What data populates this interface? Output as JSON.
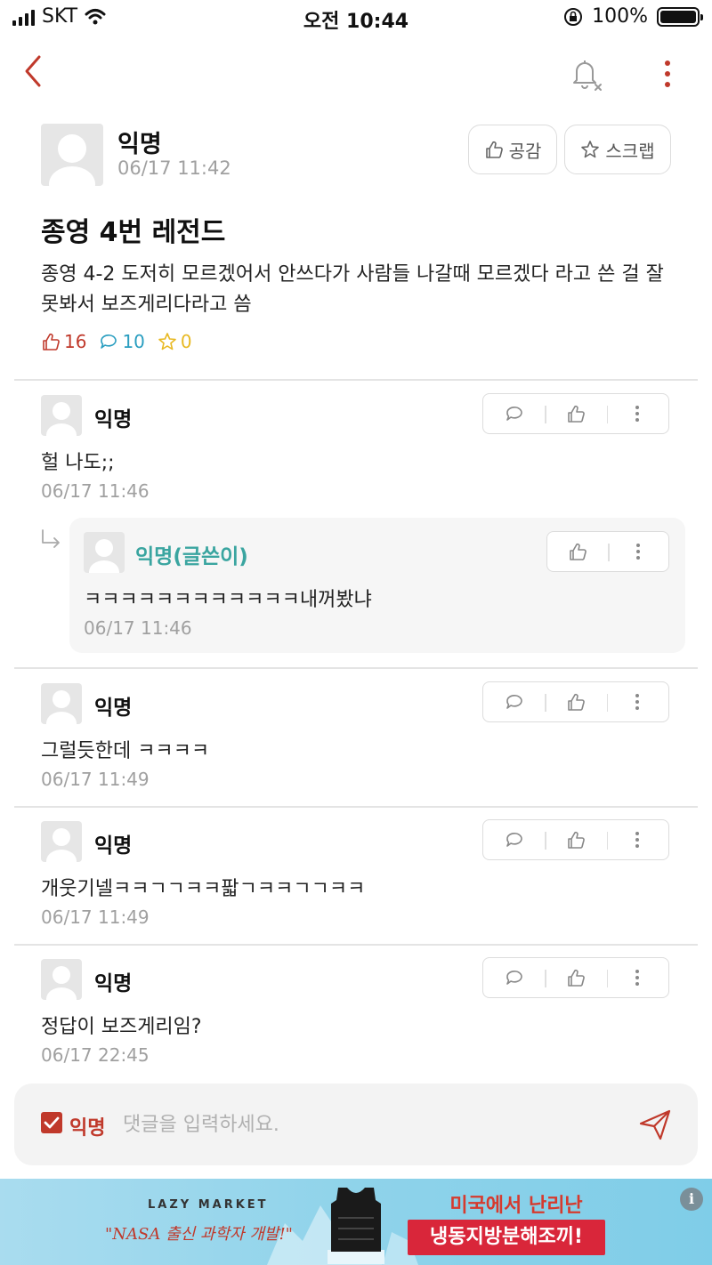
{
  "status_bar": {
    "carrier": "SKT",
    "time": "오전 10:44",
    "battery": "100%"
  },
  "post": {
    "author": "익명",
    "time": "06/17 11:42",
    "like_label": "공감",
    "scrap_label": "스크랩",
    "title": "종영 4번 레전드",
    "body": "종영 4-2 도저히 모르겠어서 안쓰다가 사람들 나갈때  모르겠다 라고 쓴 걸 잘못봐서 보즈게리다라고 씀",
    "likes": "16",
    "comments": "10",
    "scraps": "0"
  },
  "comments": [
    {
      "author": "익명",
      "text": "헐 나도;;",
      "time": "06/17 11:46"
    },
    {
      "author": "익명(글쓴이)",
      "text": "ㅋㅋㅋㅋㅋㅋㅋㅋㅋㅋㅋㅋ내꺼봤냐",
      "time": "06/17 11:46"
    },
    {
      "author": "익명",
      "text": "그럴듯한데 ㅋㅋㅋㅋ",
      "time": "06/17 11:49"
    },
    {
      "author": "익명",
      "text": "개웃기넬ㅋㅋㄱㄱㅋㅋ팗ㄱㅋㅋㄱㄱㅋㅋ",
      "time": "06/17 11:49"
    },
    {
      "author": "익명",
      "text": "정답이 보즈게리임?",
      "time": "06/17 22:45"
    }
  ],
  "input": {
    "anon_label": "익명",
    "placeholder": "댓글을 입력하세요."
  },
  "ad": {
    "brand": "LAZY MARKET",
    "slogan": "\"NASA 출신 과학자 개발!\"",
    "headline": "미국에서 난리난",
    "cta": "냉동지방분해조끼!",
    "info": "i"
  },
  "colors": {
    "accent": "#c0392b",
    "comment_count": "#2a9ec0",
    "scrap_count": "#e8b923",
    "author_highlight": "#3aa5a0"
  }
}
